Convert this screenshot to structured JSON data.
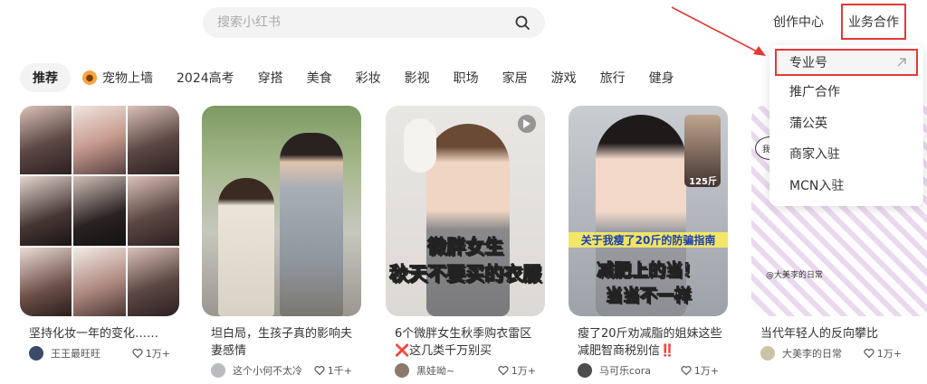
{
  "search": {
    "placeholder": "搜索小红书"
  },
  "header": {
    "creator_label": "创作中心",
    "business_label": "业务合作"
  },
  "categories": [
    "推荐",
    "宠物上墙",
    "2024高考",
    "穿搭",
    "美食",
    "彩妆",
    "影视",
    "职场",
    "家居",
    "游戏",
    "旅行",
    "健身"
  ],
  "dropdown": [
    "专业号",
    "推广合作",
    "蒲公英",
    "商家入驻",
    "MCN入驻"
  ],
  "cards": [
    {
      "title": "坚持化妆一年的变化……",
      "author": "王王最旺旺",
      "likes": "1万+"
    },
    {
      "title": "坦白局，生孩子真的影响夫妻感情",
      "author": "这个小何不太冷",
      "likes": "1千+"
    },
    {
      "title": "6个微胖女生秋季购衣雷区❌这几类千万别买",
      "author": "黑娃呦~",
      "likes": "1万+",
      "overlay1": "微胖女生",
      "overlay2": "秋天不要买的衣服"
    },
    {
      "title": "瘦了20斤劝减脂的姐妹这些减肥智商税别信‼️",
      "author": "马可乐cora",
      "likes": "1万+",
      "banner": "关于我瘦了20斤的防骗指南",
      "overlay1": "减肥上的当！",
      "overlay2": "当当不一样",
      "weight": "125斤"
    },
    {
      "title": "当代年轻人的反向攀比",
      "author": "大美李的日常",
      "likes": "1万+",
      "watermark": "@大美李的日常",
      "speech": "我斗"
    }
  ],
  "colors": {
    "highlight_red": "#e53935",
    "tag_bg": "#f3f3f3"
  }
}
